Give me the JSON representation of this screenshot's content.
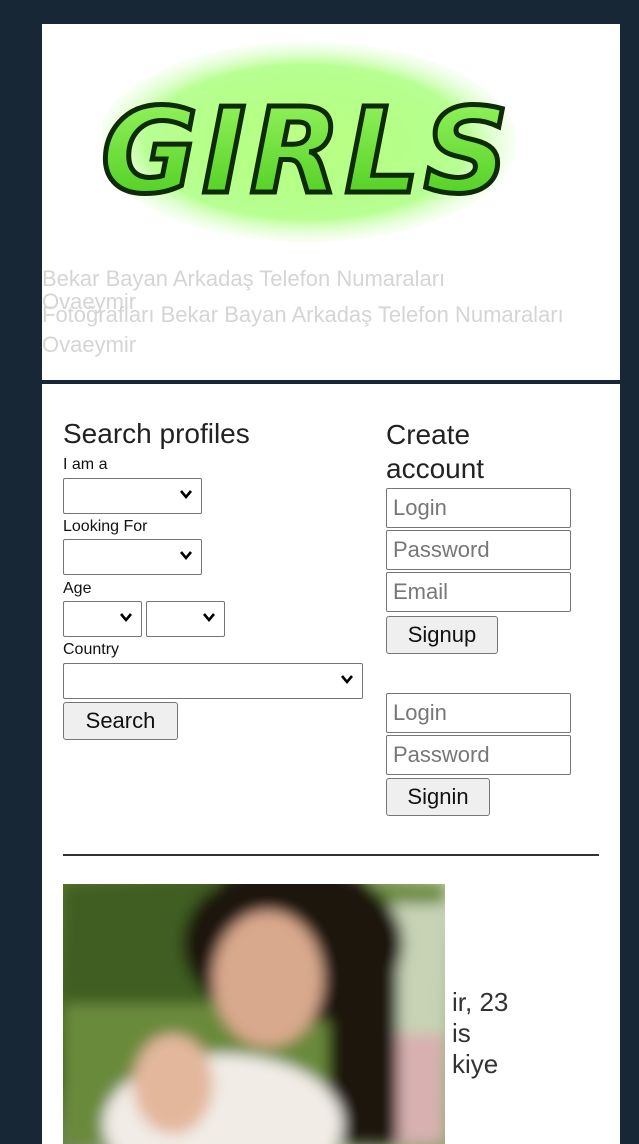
{
  "header": {
    "logo_text": "GIRLS",
    "tagline_line1": "Bekar Bayan Arkadaş Telefon Numaraları",
    "tagline_line2": "Ovaeymir",
    "tagline_line3": "Fotoğrafları Bekar Bayan Arkadaş Telefon Numaraları Ovaeymir"
  },
  "search": {
    "title": "Search profiles",
    "i_am_label": "I am a",
    "looking_for_label": "Looking For",
    "age_label": "Age",
    "country_label": "Country",
    "search_button": "Search"
  },
  "create_account": {
    "title": "Create account",
    "login_placeholder": "Login",
    "password_placeholder": "Password",
    "email_placeholder": "Email",
    "signup_button": "Signup"
  },
  "signin": {
    "login_placeholder": "Login",
    "password_placeholder": "Password",
    "signin_button": "Signin"
  },
  "profile": {
    "line1": "ir, 23",
    "line2": "is",
    "line3": "kiye"
  },
  "colors": {
    "page_bg": "#182735",
    "logo_green": "#5ce52a",
    "tagline": "#d5d5d5"
  }
}
